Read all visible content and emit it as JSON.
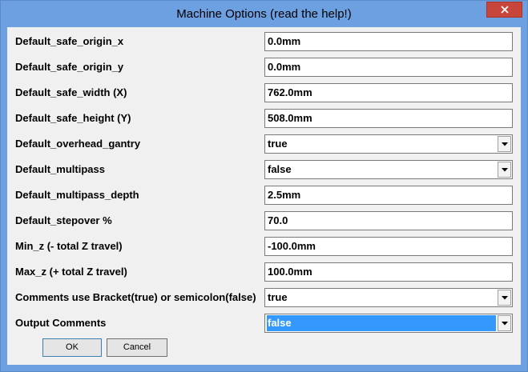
{
  "window": {
    "title": "Machine Options (read the help!)",
    "close_glyph": "✕"
  },
  "options": [
    {
      "label": "Default_safe_origin_x",
      "value": "0.0mm",
      "kind": "text"
    },
    {
      "label": "Default_safe_origin_y",
      "value": "0.0mm",
      "kind": "text"
    },
    {
      "label": "Default_safe_width (X)",
      "value": "762.0mm",
      "kind": "text"
    },
    {
      "label": "Default_safe_height (Y)",
      "value": "508.0mm",
      "kind": "text"
    },
    {
      "label": "Default_overhead_gantry",
      "value": "true",
      "kind": "select"
    },
    {
      "label": "Default_multipass",
      "value": "false",
      "kind": "select"
    },
    {
      "label": "Default_multipass_depth",
      "value": "2.5mm",
      "kind": "text"
    },
    {
      "label": "Default_stepover %",
      "value": "70.0",
      "kind": "text"
    },
    {
      "label": "Min_z (- total Z travel)",
      "value": "-100.0mm",
      "kind": "text"
    },
    {
      "label": "Max_z (+ total Z travel)",
      "value": "100.0mm",
      "kind": "text"
    },
    {
      "label": "Comments use Bracket(true) or semicolon(false)",
      "value": "true",
      "kind": "select"
    },
    {
      "label": "Output Comments",
      "value": "false",
      "kind": "select",
      "focused": true
    }
  ],
  "buttons": {
    "ok_label": "OK",
    "cancel_label": "Cancel"
  },
  "colors": {
    "title_bar": "#6da0e0",
    "close_button": "#c7453a",
    "selection_highlight": "#3399ff",
    "dialog_background": "#f0f0f0"
  },
  "icons": {
    "close": "close-icon",
    "dropdown": "chevron-down-icon"
  }
}
